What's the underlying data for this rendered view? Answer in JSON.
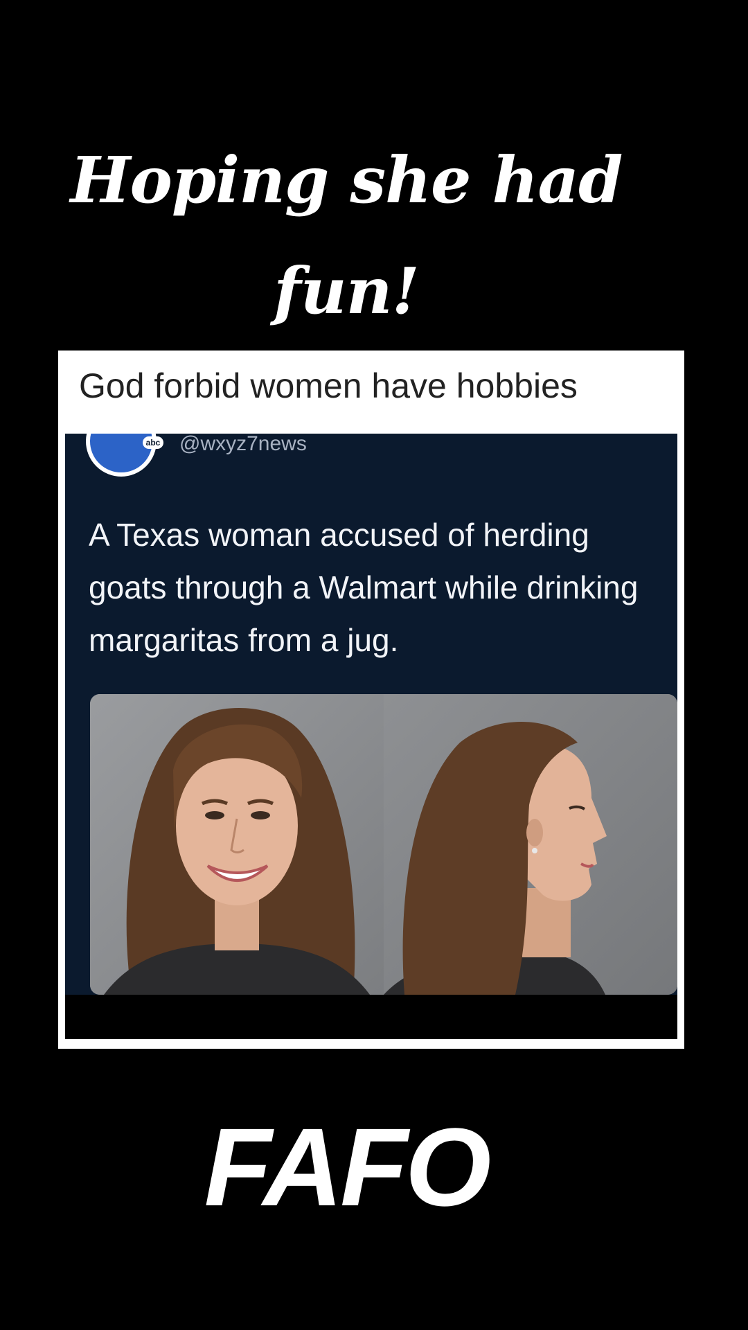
{
  "top_caption": {
    "line1": "Hoping she had",
    "line2": "fun!"
  },
  "card": {
    "header": "God forbid women have hobbies",
    "tweet": {
      "logo_badge": "abc",
      "handle": "@wxyz7news",
      "text": "A Texas woman accused of herding goats through a Walmart while drinking margaritas from a jug."
    }
  },
  "bottom_caption": "FAFO",
  "colors": {
    "background": "#000000",
    "card": "#ffffff",
    "tweet_background": "#0b1a2e",
    "logo": "#2c63c7"
  }
}
